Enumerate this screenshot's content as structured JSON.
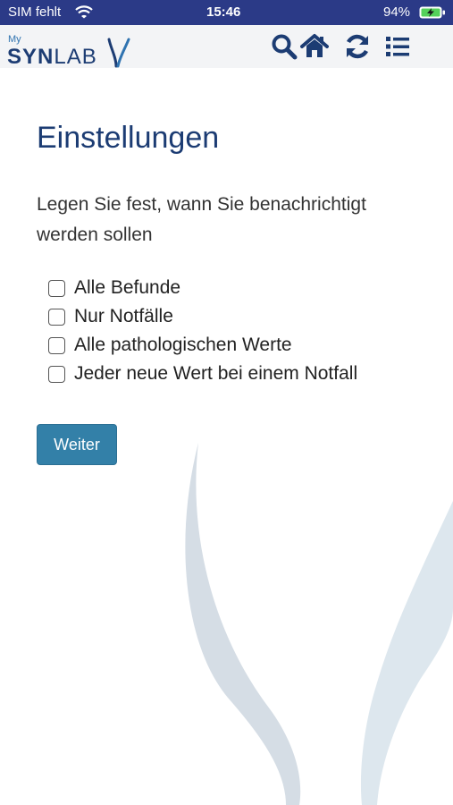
{
  "status_bar": {
    "carrier": "SIM fehlt",
    "time": "15:46",
    "battery": "94%"
  },
  "header": {
    "logo_prefix": "My",
    "logo_bold": "SYN",
    "logo_regular": "LAB",
    "icons": [
      "search-icon",
      "home-icon",
      "refresh-icon",
      "list-menu-icon"
    ]
  },
  "page": {
    "title": "Einstellungen",
    "intro": "Legen Sie fest, wann Sie benachrichtigt werden sollen",
    "options": [
      {
        "label": "Alle Befunde",
        "checked": false
      },
      {
        "label": "Nur Notfälle",
        "checked": false
      },
      {
        "label": "Alle pathologischen Werte",
        "checked": false
      },
      {
        "label": "Jeder neue Wert bei einem Notfall",
        "checked": false
      }
    ],
    "next_button": "Weiter"
  },
  "colors": {
    "status_bar": "#2b3a87",
    "brand": "#1c3c73",
    "button": "#3380a8",
    "watermark": "#d5dde5"
  }
}
